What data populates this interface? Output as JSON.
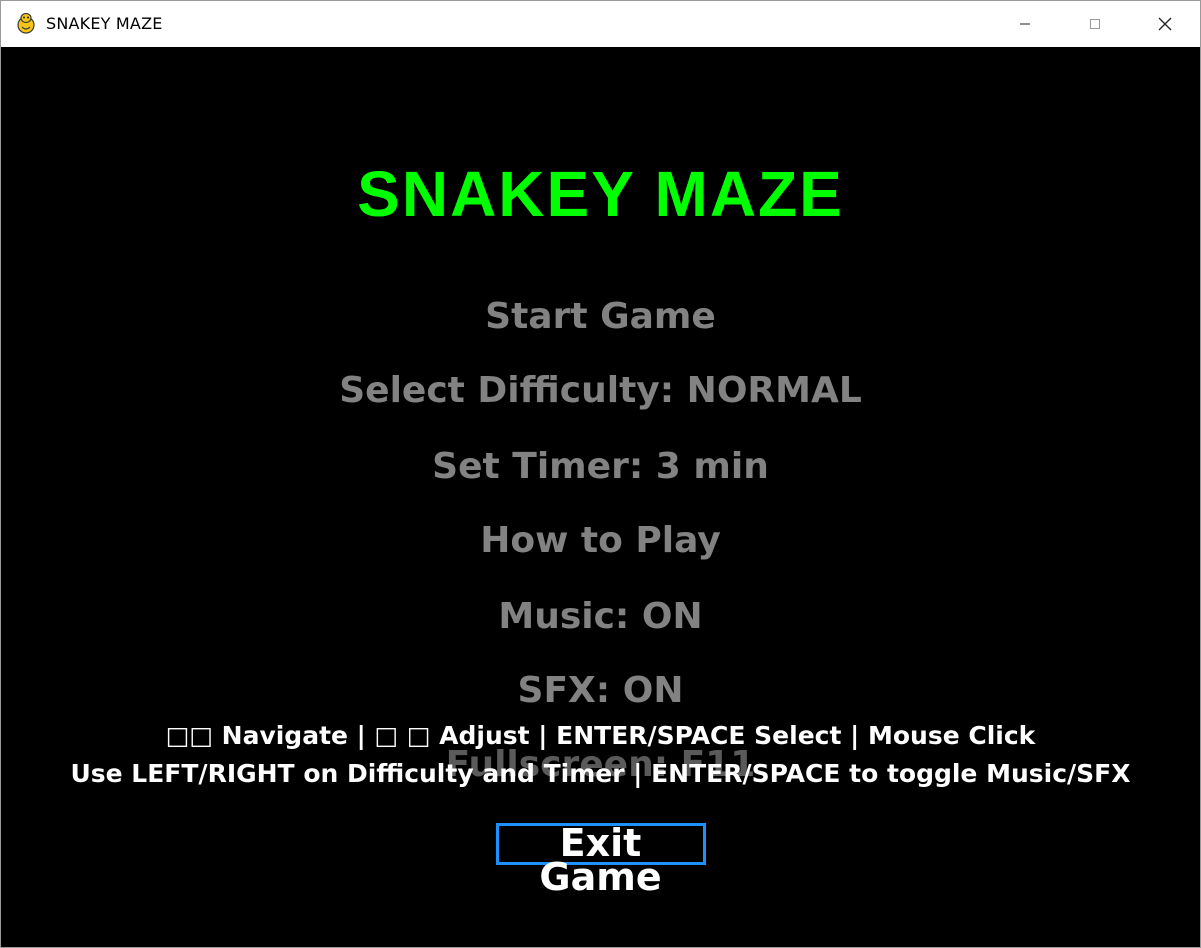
{
  "window": {
    "title": "SNAKEY MAZE",
    "app_icon": "pygame-snake-icon",
    "buttons": [
      "minimize-icon",
      "maximize-icon",
      "close-icon"
    ]
  },
  "game": {
    "title": "SNAKEY MAZE",
    "title_color": "#00ff00",
    "menu": {
      "start": "Start Game",
      "difficulty": "Select Difficulty: NORMAL",
      "timer": "Set Timer: 3 min",
      "how_to_play": "How to Play",
      "music": "Music: ON",
      "sfx": "SFX: ON",
      "fullscreen": "Fullscreen: F11",
      "exit": "Exit Game"
    },
    "selected_item": "Exit Game",
    "selection_color": "#1e90ff",
    "help_line_1": "□□ Navigate | □ □ Adjust | ENTER/SPACE Select | Mouse Click",
    "help_line_2": "Use LEFT/RIGHT on Difficulty and Timer | ENTER/SPACE to toggle Music/SFX"
  }
}
